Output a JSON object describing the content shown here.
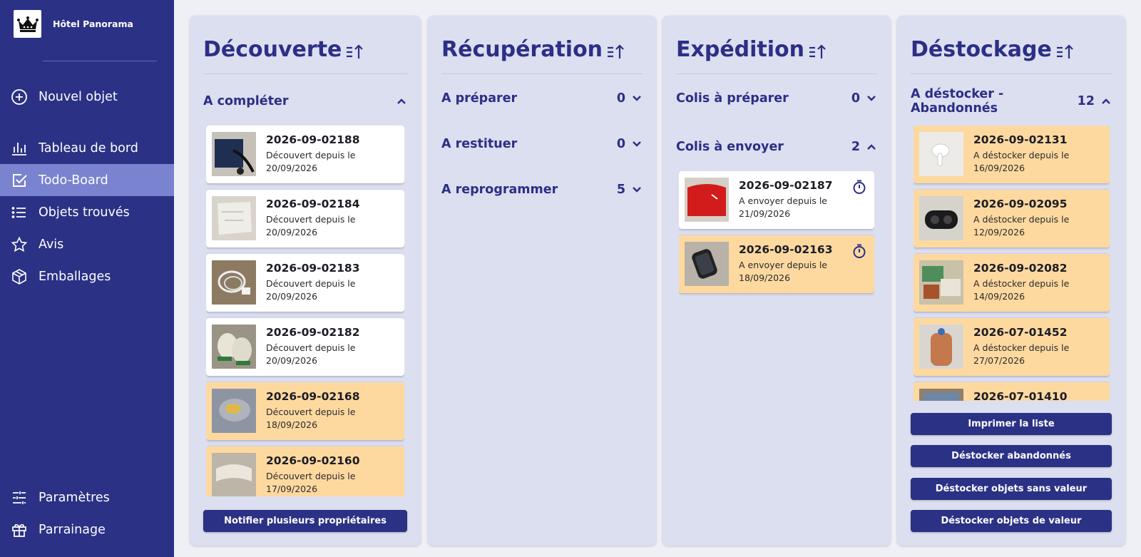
{
  "brand": {
    "name": "Hôtel Panorama",
    "logo_icon": "crown-icon"
  },
  "nav": {
    "new_object": "Nouvel objet",
    "dashboard": "Tableau de bord",
    "todo_board": "Todo-Board",
    "found_objects": "Objets trouvés",
    "reviews": "Avis",
    "packaging": "Emballages",
    "settings": "Paramètres",
    "referral": "Parrainage"
  },
  "columns": {
    "decouverte": {
      "title": "Découverte",
      "section": {
        "label": "A compléter"
      },
      "cards": [
        {
          "id": "2026-09-02188",
          "line1": "Découvert depuis le",
          "date": "20/09/2026",
          "status": "normal"
        },
        {
          "id": "2026-09-02184",
          "line1": "Découvert depuis le",
          "date": "20/09/2026",
          "status": "normal"
        },
        {
          "id": "2026-09-02183",
          "line1": "Découvert depuis le",
          "date": "20/09/2026",
          "status": "normal"
        },
        {
          "id": "2026-09-02182",
          "line1": "Découvert depuis le",
          "date": "20/09/2026",
          "status": "normal"
        },
        {
          "id": "2026-09-02168",
          "line1": "Découvert depuis le",
          "date": "18/09/2026",
          "status": "warning"
        },
        {
          "id": "2026-09-02160",
          "line1": "Découvert depuis le",
          "date": "17/09/2026",
          "status": "warning"
        }
      ],
      "button": "Notifier plusieurs propriétaires"
    },
    "recuperation": {
      "title": "Récupération",
      "sections": [
        {
          "label": "A préparer",
          "count": "0"
        },
        {
          "label": "A restituer",
          "count": "0"
        },
        {
          "label": "A reprogrammer",
          "count": "5"
        }
      ]
    },
    "expedition": {
      "title": "Expédition",
      "sections": [
        {
          "label": "Colis à préparer",
          "count": "0"
        },
        {
          "label": "Colis à envoyer",
          "count": "2"
        }
      ],
      "cards": [
        {
          "id": "2026-09-02187",
          "line1": "A envoyer depuis le",
          "date": "21/09/2026",
          "status": "normal"
        },
        {
          "id": "2026-09-02163",
          "line1": "A envoyer depuis le",
          "date": "18/09/2026",
          "status": "warning"
        }
      ]
    },
    "destockage": {
      "title": "Déstockage",
      "section": {
        "label": "A déstocker - Abandonnés",
        "count": "12"
      },
      "cards": [
        {
          "id": "2026-09-02131",
          "line1": "A déstocker depuis le",
          "date": "16/09/2026",
          "status": "warning"
        },
        {
          "id": "2026-09-02095",
          "line1": "A déstocker depuis le",
          "date": "12/09/2026",
          "status": "warning"
        },
        {
          "id": "2026-09-02082",
          "line1": "A déstocker depuis le",
          "date": "14/09/2026",
          "status": "warning"
        },
        {
          "id": "2026-07-01452",
          "line1": "A déstocker depuis le",
          "date": "27/07/2026",
          "status": "warning"
        },
        {
          "id": "2026-07-01410",
          "line1": "",
          "date": "",
          "status": "warning"
        }
      ],
      "buttons": {
        "print": "Imprimer la liste",
        "abandoned": "Déstocker abandonnés",
        "no_value": "Déstocker objets sans valeur",
        "valuable": "Déstocker objets de valeur"
      }
    }
  },
  "colors": {
    "sidebar": "#2b3185",
    "active_nav": "#7a83cf",
    "column_bg": "#dcdfef",
    "card_warning": "#fdd9a0",
    "text_primary": "#2b2f86"
  }
}
